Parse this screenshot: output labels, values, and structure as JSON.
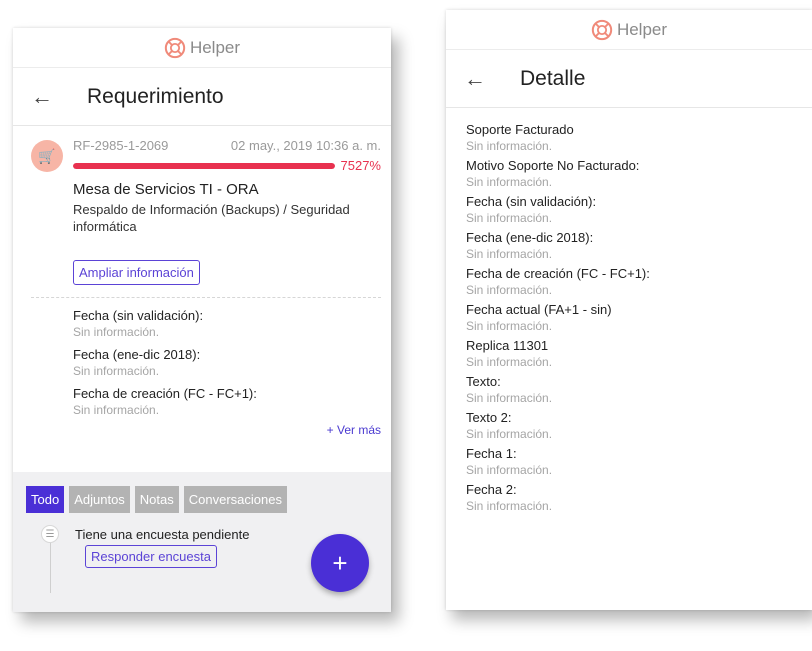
{
  "brand": {
    "name": "Helper",
    "logo_icon": "lifebuoy-icon"
  },
  "left": {
    "title": "Requerimiento",
    "ticket": {
      "id": "RF-2985-1-2069",
      "date": "02 may., 2019 10:36 a. m.",
      "progress_label": "7527%",
      "progress_fraction": 1.0,
      "service": "Mesa de Servicios TI - ORA",
      "category": "Respaldo de Información (Backups) / Seguridad informática",
      "expand_label": "Ampliar información"
    },
    "fields": [
      {
        "label": "Fecha (sin validación):",
        "value": "Sin información."
      },
      {
        "label": "Fecha (ene-dic 2018):",
        "value": "Sin información."
      },
      {
        "label": "Fecha de creación (FC - FC+1):",
        "value": "Sin información."
      }
    ],
    "see_more": "+ Ver más",
    "tabs": [
      "Todo",
      "Adjuntos",
      "Notas",
      "Conversaciones"
    ],
    "active_tab": "Todo",
    "timeline": {
      "text": "Tiene una encuesta pendiente",
      "button": "Responder encuesta"
    },
    "fab_label": "+"
  },
  "right": {
    "title": "Detalle",
    "fields": [
      {
        "label": "Soporte Facturado",
        "value": "Sin información."
      },
      {
        "label": "Motivo Soporte No Facturado:",
        "value": "Sin información."
      },
      {
        "label": "Fecha (sin validación):",
        "value": "Sin información."
      },
      {
        "label": "Fecha (ene-dic 2018):",
        "value": "Sin información."
      },
      {
        "label": "Fecha de creación (FC - FC+1):",
        "value": "Sin información."
      },
      {
        "label": "Fecha actual (FA+1 - sin)",
        "value": "Sin información."
      },
      {
        "label": "Replica 11301",
        "value": "Sin información."
      },
      {
        "label": "Texto:",
        "value": "Sin información."
      },
      {
        "label": "Texto 2:",
        "value": "Sin información."
      },
      {
        "label": "Fecha 1:",
        "value": "Sin información."
      },
      {
        "label": "Fecha 2:",
        "value": "Sin información."
      }
    ]
  },
  "colors": {
    "accent": "#4a2fd6",
    "progress": "#e8314f",
    "avatar": "#f7b5a6",
    "muted": "#a5a5a5"
  }
}
